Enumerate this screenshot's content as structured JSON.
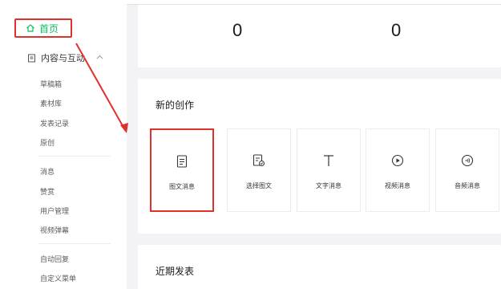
{
  "nav": {
    "home_label": "首页",
    "section_label": "内容与互动",
    "group1": [
      "草稿箱",
      "素材库",
      "发表记录",
      "原创"
    ],
    "group2": [
      "消息",
      "赞赏",
      "用户管理",
      "视频弹幕"
    ],
    "group3": [
      "自动回复",
      "自定义菜单"
    ]
  },
  "stats": {
    "left_value": "0",
    "right_value": "0"
  },
  "create": {
    "title": "新的创作",
    "tiles": [
      {
        "label": "图文消息",
        "icon": "document-icon"
      },
      {
        "label": "选择图文",
        "icon": "select-article-icon"
      },
      {
        "label": "文字消息",
        "icon": "text-icon"
      },
      {
        "label": "视频消息",
        "icon": "play-icon"
      },
      {
        "label": "音频消息",
        "icon": "audio-icon"
      }
    ]
  },
  "recent": {
    "title": "近期发表"
  },
  "colors": {
    "accent_green": "#07c160",
    "highlight_red": "#e0312c"
  }
}
